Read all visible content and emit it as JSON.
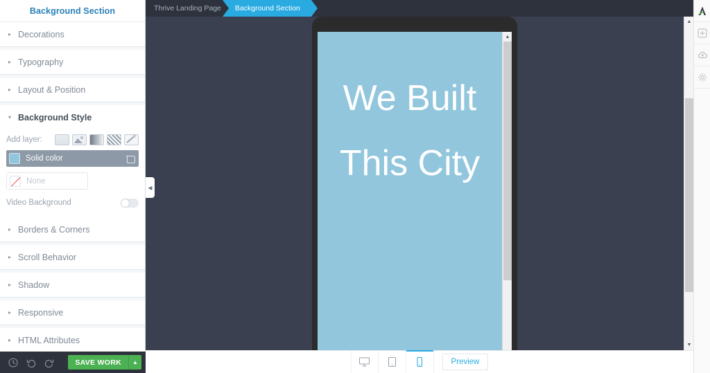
{
  "sidebar": {
    "header_title": "Background Section",
    "sections": [
      {
        "label": "Decorations",
        "expanded": false
      },
      {
        "label": "Typography",
        "expanded": false
      },
      {
        "label": "Layout & Position",
        "expanded": false
      },
      {
        "label": "Background Style",
        "expanded": true
      },
      {
        "label": "Borders & Corners",
        "expanded": false
      },
      {
        "label": "Scroll Behavior",
        "expanded": false
      },
      {
        "label": "Shadow",
        "expanded": false
      },
      {
        "label": "Responsive",
        "expanded": false
      },
      {
        "label": "HTML Attributes",
        "expanded": false
      }
    ],
    "background_style": {
      "add_layer_label": "Add layer:",
      "layer_icons": [
        "solid-color-layer-icon",
        "image-layer-icon",
        "gradient-layer-icon",
        "pattern-layer-icon",
        "magic-layer-icon"
      ],
      "layers": [
        {
          "name": "Solid color",
          "selected": true,
          "swatch_color": "#92c6dd"
        },
        {
          "name": "None",
          "selected": false
        }
      ],
      "video_background_label": "Video Background",
      "video_background_on": false
    }
  },
  "footer": {
    "history_icon": "clock-icon",
    "undo_icon": "undo-icon",
    "redo_icon": "redo-icon",
    "save_label": "SAVE WORK",
    "save_dropdown_icon": "chevron-up-icon",
    "save_color": "#4cb153"
  },
  "topbar": {
    "breadcrumbs": [
      {
        "label": "Thrive Landing Page",
        "active": false
      },
      {
        "label": "Background Section",
        "active": true
      }
    ],
    "active_color": "#29abe2"
  },
  "canvas": {
    "background_color": "#3a4050",
    "collapse_handle_icon": "chevron-left-icon",
    "phone": {
      "screen_color": "#92c6dd",
      "headlines": [
        "We Built",
        "This City"
      ],
      "text_color": "#ffffff"
    }
  },
  "right_rail": {
    "items": [
      {
        "icon": "thrive-logo-icon",
        "name": "logo"
      },
      {
        "icon": "plus-square-icon",
        "name": "add"
      },
      {
        "icon": "cloud-icon",
        "name": "cloud-templates"
      },
      {
        "icon": "gear-icon",
        "name": "settings"
      }
    ]
  },
  "bottombar": {
    "devices": [
      {
        "icon": "desktop-icon",
        "name": "desktop",
        "active": false
      },
      {
        "icon": "tablet-icon",
        "name": "tablet",
        "active": false
      },
      {
        "icon": "mobile-icon",
        "name": "mobile",
        "active": true
      }
    ],
    "preview_label": "Preview"
  }
}
